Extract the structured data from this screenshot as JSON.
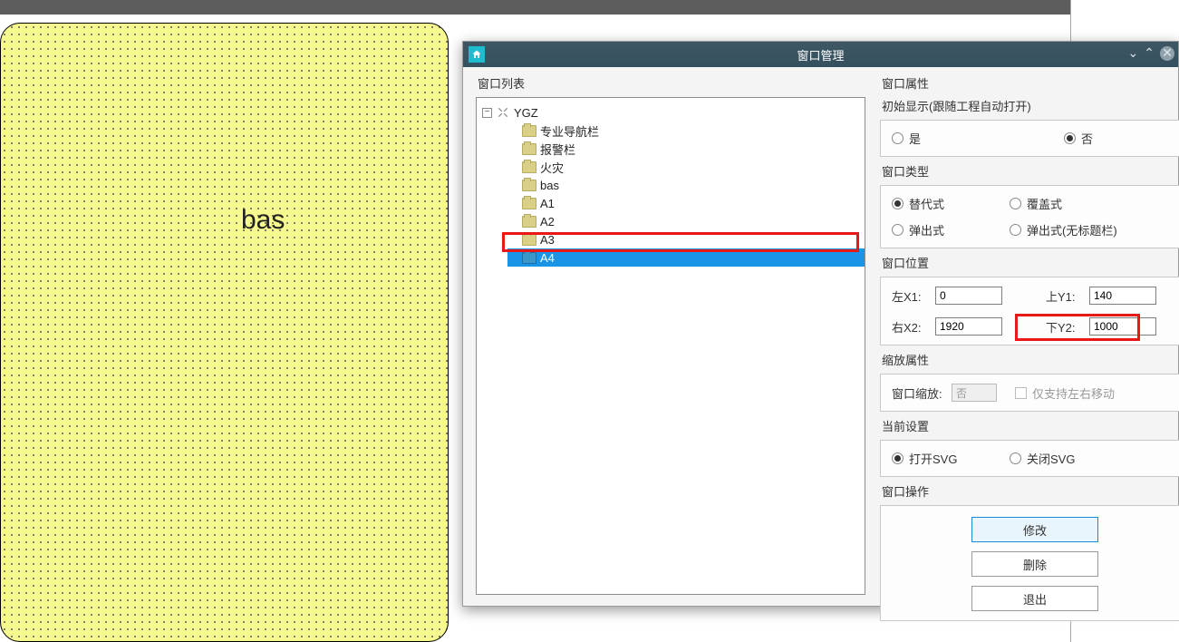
{
  "canvas": {
    "label": "bas"
  },
  "dialog": {
    "title": "窗口管理",
    "left_section_label": "窗口列表",
    "tree": {
      "root": "YGZ",
      "items": [
        "专业导航栏",
        "报警栏",
        "火灾",
        "bas",
        "A1",
        "A2",
        "A3",
        "A4"
      ],
      "selected_index": 7
    }
  },
  "props": {
    "section_label": "窗口属性",
    "init_label": "初始显示(跟随工程自动打开)",
    "init_yes": "是",
    "init_no": "否",
    "init_value": "no",
    "type_label": "窗口类型",
    "type_options": {
      "replace": "替代式",
      "overlay": "覆盖式",
      "popup": "弹出式",
      "popup_noframe": "弹出式(无标题栏)"
    },
    "type_value": "replace",
    "pos_label": "窗口位置",
    "pos": {
      "x1_label": "左X1:",
      "x1": "0",
      "y1_label": "上Y1:",
      "y1": "140",
      "x2_label": "右X2:",
      "x2": "1920",
      "y2_label": "下Y2:",
      "y2": "1000"
    },
    "zoom_label": "缩放属性",
    "zoom_field_label": "窗口缩放:",
    "zoom_value": "否",
    "zoom_chk_label": "仅支持左右移动",
    "svg_label": "当前设置",
    "svg_open": "打开SVG",
    "svg_close": "关闭SVG",
    "svg_value": "open",
    "ops_label": "窗口操作",
    "btn_modify": "修改",
    "btn_delete": "删除",
    "btn_exit": "退出"
  }
}
